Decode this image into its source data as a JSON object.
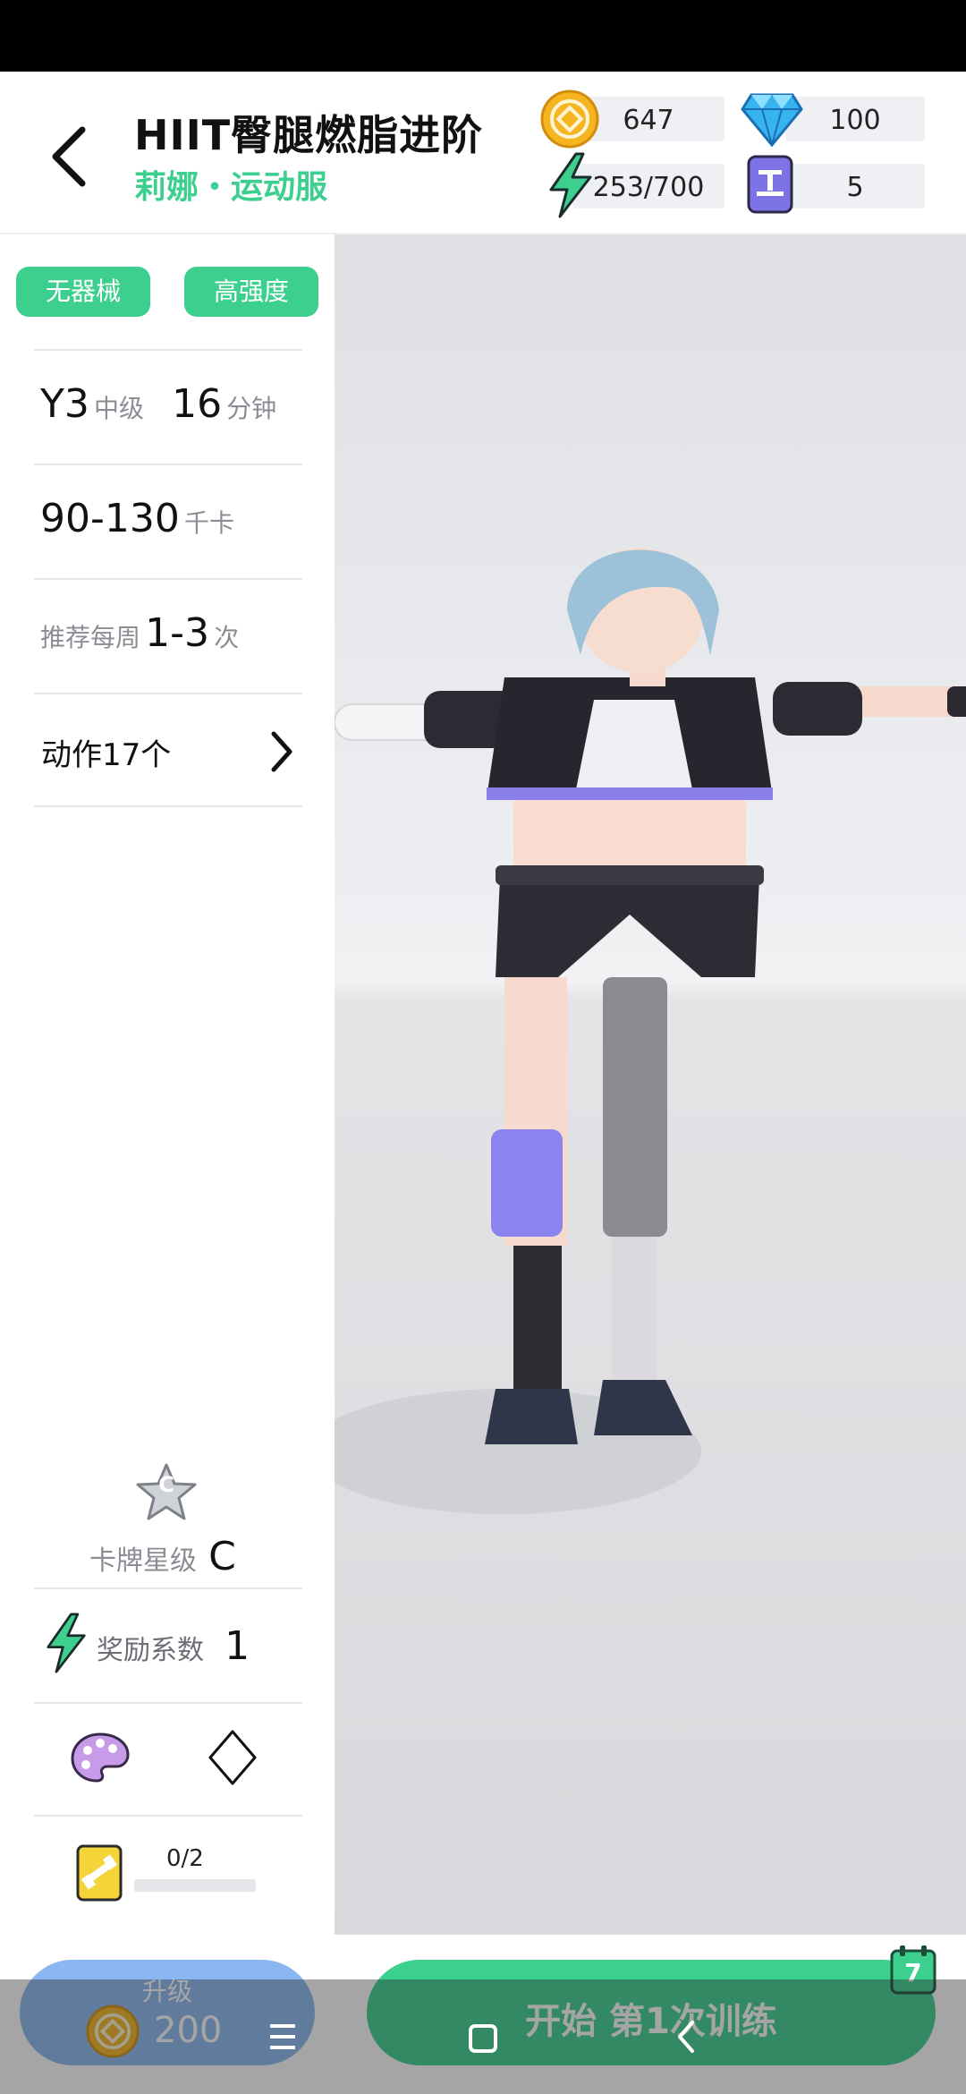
{
  "header": {
    "title": "HIIT臀腿燃脂进阶",
    "subtitle": "莉娜・运动服"
  },
  "resources": {
    "coins": "647",
    "diamonds": "100",
    "energy": "253/700",
    "tickets": "5"
  },
  "tags": [
    "无器械",
    "高强度"
  ],
  "stats": {
    "level": "Y3",
    "level_label": "中级",
    "minutes": "16",
    "minutes_label": "分钟",
    "calories": "90-130",
    "calories_label": "千卡",
    "weekly_prefix": "推荐每周",
    "weekly": "1-3",
    "weekly_suffix": "次",
    "moves": "动作17个"
  },
  "card": {
    "badge_letter": "C",
    "star_label": "卡牌星级",
    "star_value": "C",
    "reward_label": "奖励系数",
    "reward_value": "1",
    "progress": "0/2",
    "progress_fraction": 0.0
  },
  "bottom": {
    "upgrade_label": "升级",
    "upgrade_cost": "200",
    "start_label": "开始 第1次训练",
    "calendar_day": "7"
  },
  "colors": {
    "accent_green": "#3ccf8e",
    "coin_gold": "#f5b521",
    "diamond_blue": "#37b4f0",
    "ticket_purple": "#7d73e6",
    "upgrade_blue": "#8ab7f2"
  }
}
